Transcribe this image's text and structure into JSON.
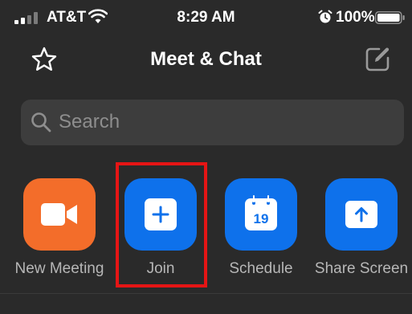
{
  "status_bar": {
    "carrier": "AT&T",
    "time": "8:29 AM",
    "battery_percent": "100%",
    "icons": [
      "signal-icon",
      "wifi-icon",
      "alarm-icon",
      "battery-icon"
    ]
  },
  "nav": {
    "title": "Meet & Chat",
    "left_icon": "star-icon",
    "right_icon": "compose-icon"
  },
  "search": {
    "placeholder": "Search",
    "icon": "search-icon"
  },
  "actions": [
    {
      "label": "New Meeting",
      "icon": "video-camera-icon",
      "color": "#f36d2a"
    },
    {
      "label": "Join",
      "icon": "plus-icon",
      "color": "#0e71eb"
    },
    {
      "label": "Schedule",
      "icon": "calendar-icon",
      "calendar_day": "19",
      "color": "#0e71eb"
    },
    {
      "label": "Share Screen",
      "icon": "share-screen-icon",
      "color": "#0e71eb"
    }
  ],
  "highlight": {
    "target": "Join",
    "color": "#e51515"
  },
  "colors": {
    "background": "#2a2a2a",
    "search_background": "#3d3d3d",
    "label_text": "#b7b7b7"
  }
}
